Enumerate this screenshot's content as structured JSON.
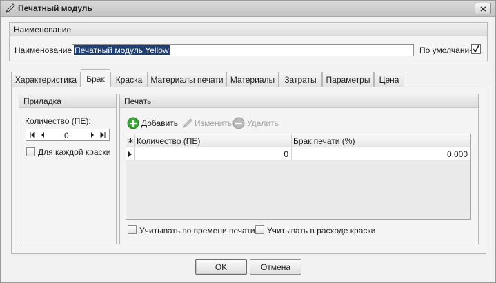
{
  "window": {
    "title": "Печатный модуль",
    "icon": "pen-icon"
  },
  "name_group": {
    "header": "Наименование",
    "name_label": "Наименование:",
    "name_value": "Печатный модуль Yellow",
    "default_label": "По умолчанию",
    "default_checked": true
  },
  "tabs": [
    {
      "label": "Характеристика"
    },
    {
      "label": "Брак"
    },
    {
      "label": "Краска"
    },
    {
      "label": "Материалы печати"
    },
    {
      "label": "Материалы"
    },
    {
      "label": "Затраты"
    },
    {
      "label": "Параметры"
    },
    {
      "label": "Цена"
    }
  ],
  "active_tab": "Брак",
  "pridadka": {
    "header": "Приладка",
    "qty_label": "Количество (ПЕ):",
    "qty_value": "0",
    "each_paint_label": "Для каждой краски",
    "each_paint_checked": false
  },
  "pechat": {
    "header": "Печать",
    "add_label": "Добавить",
    "edit_label": "Изменить",
    "delete_label": "Удалить",
    "columns": [
      "Количество (ПЕ)",
      "Брак печати (%)"
    ],
    "rows": [
      {
        "qty": "0",
        "waste": "0,000"
      }
    ],
    "time_label": "Учитывать во времени печати",
    "ink_label": "Учитывать в расходе краски"
  },
  "buttons": {
    "ok": "OK",
    "cancel": "Отмена"
  },
  "colors": {
    "selection": "#1f3f73",
    "add_icon": "#3aa635"
  }
}
